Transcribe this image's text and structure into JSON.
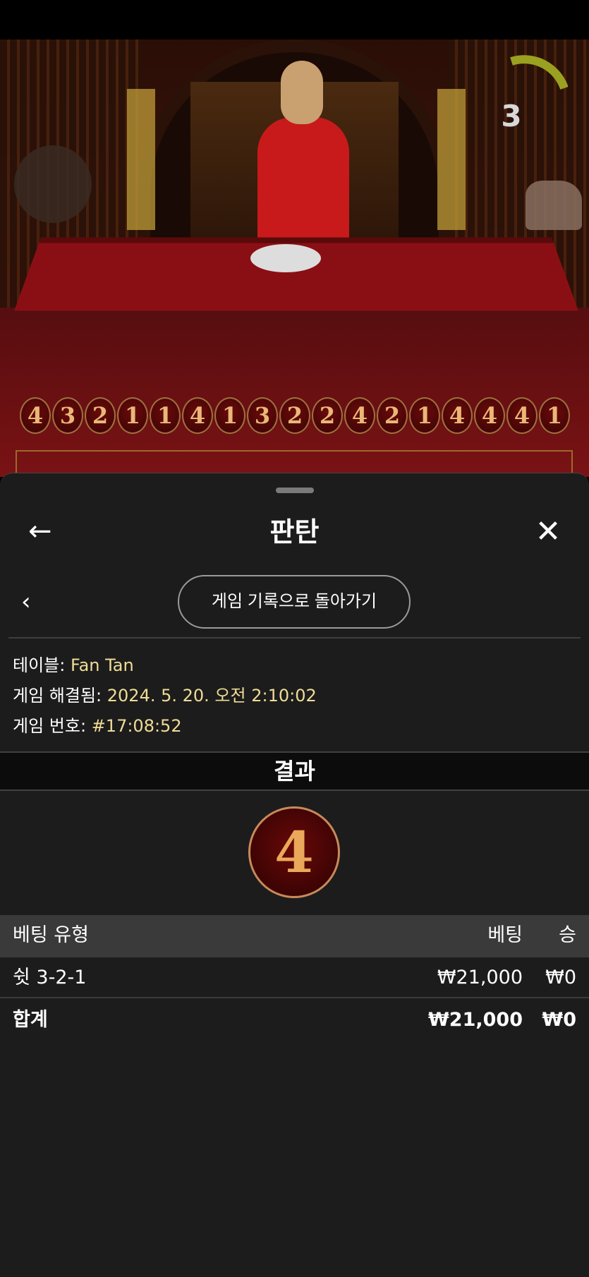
{
  "timer": {
    "count": "3",
    "progress": 0.3
  },
  "road": {
    "results": [
      "4",
      "3",
      "2",
      "1",
      "1",
      "4",
      "1",
      "3",
      "2",
      "2",
      "4",
      "2",
      "1",
      "4",
      "4",
      "4",
      "1"
    ]
  },
  "sheet": {
    "title": "판탄",
    "back_icon": "arrow-left-icon",
    "close_icon": "close-icon",
    "history_button": "게임 기록으로 돌아가기"
  },
  "info": {
    "table_label": "테이블:",
    "table_value": "Fan Tan",
    "resolved_label": "게임 해결됨:",
    "resolved_value": "2024. 5. 20. 오전 2:10:02",
    "number_label": "게임 번호:",
    "number_value": "#17:08:52"
  },
  "result": {
    "header": "결과",
    "value": "4"
  },
  "bets_table": {
    "headers": {
      "type": "베팅 유형",
      "bet": "베팅",
      "win": "승"
    },
    "rows": [
      {
        "type": "쉿 3-2-1",
        "bet": "₩21,000",
        "win": "₩0"
      }
    ],
    "total": {
      "type": "합계",
      "bet": "₩21,000",
      "win": "₩0"
    }
  },
  "colors": {
    "accent": "#f0dc96",
    "sheet_bg": "#1c1c1c",
    "ball_border": "#c88a5a"
  }
}
